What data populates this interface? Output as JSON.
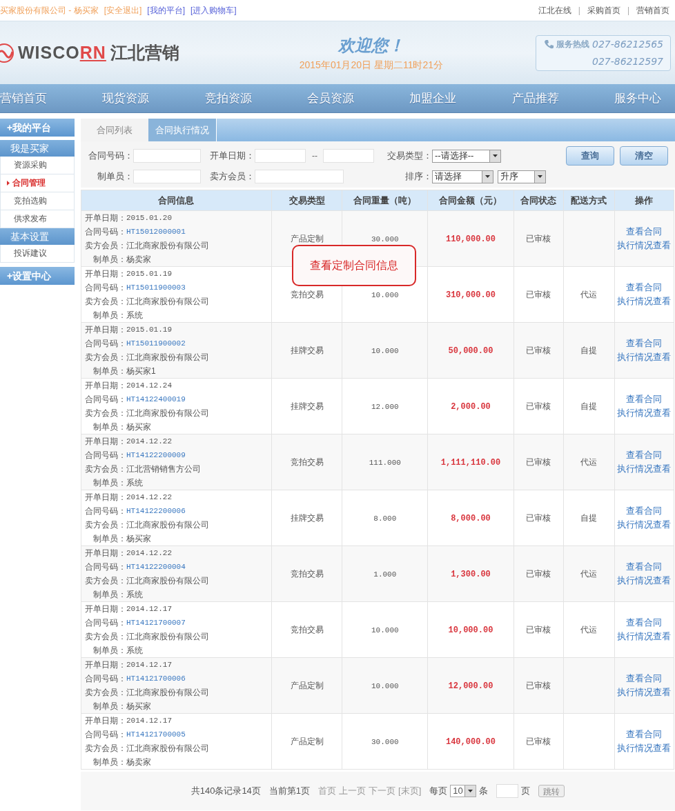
{
  "top_bar": {
    "user": "买家股份有限公司 - 杨买家",
    "links": [
      {
        "text": "[安全退出]",
        "kind": "logout"
      },
      {
        "text": "[我的平台]",
        "kind": "nav"
      },
      {
        "text": "[进入购物车]",
        "kind": "nav"
      }
    ],
    "right_links": [
      "江北在线",
      "采购首页",
      "营销首页"
    ],
    "separators": [
      "|",
      "|"
    ]
  },
  "header": {
    "wordmark": [
      "WISCO",
      "RN"
    ],
    "brand_cn": "江北营销",
    "welcome": "欢迎您！",
    "datetime": "2015年01月20日 星期二11时21分",
    "hotline_label": "服务热线",
    "phones": [
      "027-86212565",
      "027-86212597"
    ]
  },
  "nav": [
    "营销首页",
    "现货资源",
    "竞拍资源",
    "会员资源",
    "加盟企业",
    "产品推荐",
    "服务中心"
  ],
  "sidebar": {
    "sections": [
      {
        "title": "+我的平台",
        "kind": "main"
      },
      {
        "title": "我是买家",
        "kind": "sub",
        "items": [
          {
            "label": "资源采购",
            "selected": false
          },
          {
            "label": "合同管理",
            "selected": true
          },
          {
            "label": "竞拍选购",
            "selected": false
          },
          {
            "label": "供求发布",
            "selected": false
          }
        ]
      },
      {
        "title": "基本设置",
        "kind": "sub",
        "items": [
          {
            "label": "投诉建议",
            "selected": false
          }
        ]
      },
      {
        "title": "+设置中心",
        "kind": "main"
      }
    ]
  },
  "tabs": [
    {
      "label": "合同列表",
      "selected": true
    },
    {
      "label": "合同执行情况",
      "selected": false
    }
  ],
  "filters": {
    "contract_no": {
      "label": "合同号码："
    },
    "open_date": {
      "label": "开单日期：",
      "separator": "--"
    },
    "trade_type": {
      "label": "交易类型：",
      "value": "--请选择--"
    },
    "creator": {
      "label": "制单员："
    },
    "seller": {
      "label": "卖方会员："
    },
    "sort": {
      "label": "排序：",
      "value": "请选择",
      "order": "升序"
    },
    "buttons": [
      "查询",
      "清空"
    ]
  },
  "table": {
    "columns": [
      "合同信息",
      "交易类型",
      "合同重量（吨）",
      "合同金额（元）",
      "合同状态",
      "配送方式",
      "操作"
    ],
    "rows": [
      {
        "date_label": "开单日期：",
        "date": "2015.01.20",
        "code_label": "合同号码：",
        "code": "HT15012000001",
        "seller_label": "卖方会员：",
        "seller": "江北商家股份有限公司",
        "creator_label": "制单员：",
        "creator": "杨卖家",
        "type": "产品定制",
        "weight": "30.000",
        "amount": "110,000.00",
        "status": "已审核",
        "actions": [
          "查看合同",
          "执行情况查看"
        ]
      },
      {
        "date_label": "开单日期：",
        "date": "2015.01.19",
        "code_label": "合同号码：",
        "code": "HT15011900003",
        "seller_label": "卖方会员：",
        "seller": "江北商家股份有限公司",
        "creator_label": "制单员：",
        "creator": "系统",
        "type": "竞拍交易",
        "weight": "10.000",
        "amount": "310,000.00",
        "status": "已审核",
        "delivery": "代运",
        "actions": [
          "查看合同",
          "执行情况查看"
        ]
      },
      {
        "date_label": "开单日期：",
        "date": "2015.01.19",
        "code_label": "合同号码：",
        "code": "HT15011900002",
        "seller_label": "卖方会员：",
        "seller": "江北商家股份有限公司",
        "creator_label": "制单员：",
        "creator": "杨买家1",
        "type": "挂牌交易",
        "weight": "10.000",
        "amount": "50,000.00",
        "status": "已审核",
        "delivery": "自提",
        "actions": [
          "查看合同",
          "执行情况查看"
        ]
      },
      {
        "date_label": "开单日期：",
        "date": "2014.12.24",
        "code_label": "合同号码：",
        "code": "HT14122400019",
        "seller_label": "卖方会员：",
        "seller": "江北商家股份有限公司",
        "creator_label": "制单员：",
        "creator": "杨买家",
        "type": "挂牌交易",
        "weight": "12.000",
        "amount": "2,000.00",
        "status": "已审核",
        "delivery": "自提",
        "actions": [
          "查看合同",
          "执行情况查看"
        ]
      },
      {
        "date_label": "开单日期：",
        "date": "2014.12.22",
        "code_label": "合同号码：",
        "code": "HT14122200009",
        "seller_label": "卖方会员：",
        "seller": "江北营销销售方公司",
        "creator_label": "制单员：",
        "creator": "系统",
        "type": "竞拍交易",
        "weight": "111.000",
        "amount": "1,111,110.00",
        "status": "已审核",
        "delivery": "代运",
        "actions": [
          "查看合同",
          "执行情况查看"
        ]
      },
      {
        "date_label": "开单日期：",
        "date": "2014.12.22",
        "code_label": "合同号码：",
        "code": "HT14122200006",
        "seller_label": "卖方会员：",
        "seller": "江北商家股份有限公司",
        "creator_label": "制单员：",
        "creator": "杨买家",
        "type": "挂牌交易",
        "weight": "8.000",
        "amount": "8,000.00",
        "status": "已审核",
        "delivery": "自提",
        "actions": [
          "查看合同",
          "执行情况查看"
        ]
      },
      {
        "date_label": "开单日期：",
        "date": "2014.12.22",
        "code_label": "合同号码：",
        "code": "HT14122200004",
        "seller_label": "卖方会员：",
        "seller": "江北商家股份有限公司",
        "creator_label": "制单员：",
        "creator": "系统",
        "type": "竞拍交易",
        "weight": "1.000",
        "amount": "1,300.00",
        "status": "已审核",
        "delivery": "代运",
        "actions": [
          "查看合同",
          "执行情况查看"
        ]
      },
      {
        "date_label": "开单日期：",
        "date": "2014.12.17",
        "code_label": "合同号码：",
        "code": "HT14121700007",
        "seller_label": "卖方会员：",
        "seller": "江北商家股份有限公司",
        "creator_label": "制单员：",
        "creator": "系统",
        "type": "竞拍交易",
        "weight": "10.000",
        "amount": "10,000.00",
        "status": "已审核",
        "delivery": "代运",
        "actions": [
          "查看合同",
          "执行情况查看"
        ]
      },
      {
        "date_label": "开单日期：",
        "date": "2014.12.17",
        "code_label": "合同号码：",
        "code": "HT14121700006",
        "seller_label": "卖方会员：",
        "seller": "江北商家股份有限公司",
        "creator_label": "制单员：",
        "creator": "杨买家",
        "type": "产品定制",
        "weight": "10.000",
        "amount": "12,000.00",
        "status": "已审核",
        "actions": [
          "查看合同",
          "执行情况查看"
        ]
      },
      {
        "date_label": "开单日期：",
        "date": "2014.12.17",
        "code_label": "合同号码：",
        "code": "HT14121700005",
        "seller_label": "卖方会员：",
        "seller": "江北商家股份有限公司",
        "creator_label": "制单员：",
        "creator": "杨卖家",
        "type": "产品定制",
        "weight": "30.000",
        "amount": "140,000.00",
        "status": "已审核",
        "actions": [
          "查看合同",
          "执行情况查看"
        ]
      }
    ]
  },
  "tooltip": "查看定制合同信息",
  "pagination": {
    "summary": "共140条记录14页",
    "current": "当前第1页",
    "links": [
      "首页",
      "上一页",
      "下一页",
      "[末页]"
    ],
    "per_page_label": "每页",
    "per_page": "10",
    "per_page_unit": "条",
    "page_unit": "页",
    "jump": "跳转"
  }
}
